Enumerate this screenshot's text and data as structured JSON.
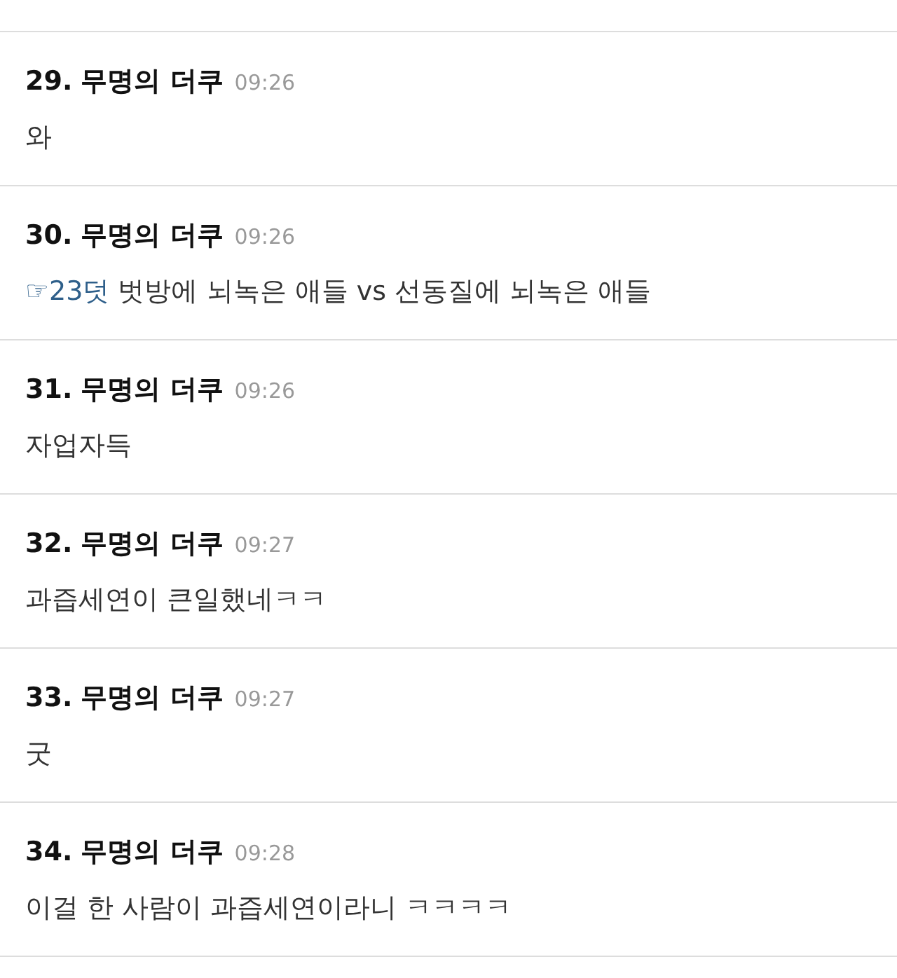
{
  "comments": [
    {
      "number": "29.",
      "author": "무명의 더쿠",
      "time": "09:26",
      "text": "와"
    },
    {
      "number": "30.",
      "author": "무명의 더쿠",
      "time": "09:26",
      "reply_link": "☞23덧",
      "text": "벗방에 뇌녹은 애들 vs 선동질에 뇌녹은 애들"
    },
    {
      "number": "31.",
      "author": "무명의 더쿠",
      "time": "09:26",
      "text": "자업자득"
    },
    {
      "number": "32.",
      "author": "무명의 더쿠",
      "time": "09:27",
      "text": "과즙세연이 큰일했네ㅋㅋ"
    },
    {
      "number": "33.",
      "author": "무명의 더쿠",
      "time": "09:27",
      "text": "굿"
    },
    {
      "number": "34.",
      "author": "무명의 더쿠",
      "time": "09:28",
      "text": "이걸 한 사람이 과즙세연이라니 ㅋㅋㅋㅋ"
    }
  ]
}
